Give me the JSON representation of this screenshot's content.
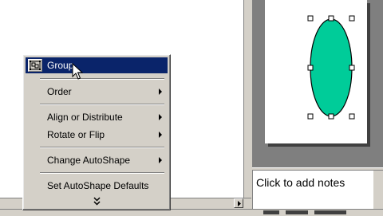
{
  "context_menu": {
    "items": [
      {
        "label": "Group",
        "highlighted": true,
        "submenu": false
      },
      {
        "label": "Order",
        "highlighted": false,
        "submenu": true
      },
      {
        "label": "Align or Distribute",
        "highlighted": false,
        "submenu": true
      },
      {
        "label": "Rotate or Flip",
        "highlighted": false,
        "submenu": true
      },
      {
        "label": "Change AutoShape",
        "highlighted": false,
        "submenu": true
      },
      {
        "label": "Set AutoShape Defaults",
        "highlighted": false,
        "submenu": false
      }
    ],
    "expand_icon": "double-chevron-down-icon"
  },
  "notes": {
    "placeholder": "Click to add notes"
  },
  "slide": {
    "shape": "oval",
    "shape_fill": "#00cc99",
    "shape_selected": true
  },
  "colors": {
    "menu_bg": "#d4d0c8",
    "highlight": "#0a246a",
    "pane_bg": "#7f7f7f"
  }
}
